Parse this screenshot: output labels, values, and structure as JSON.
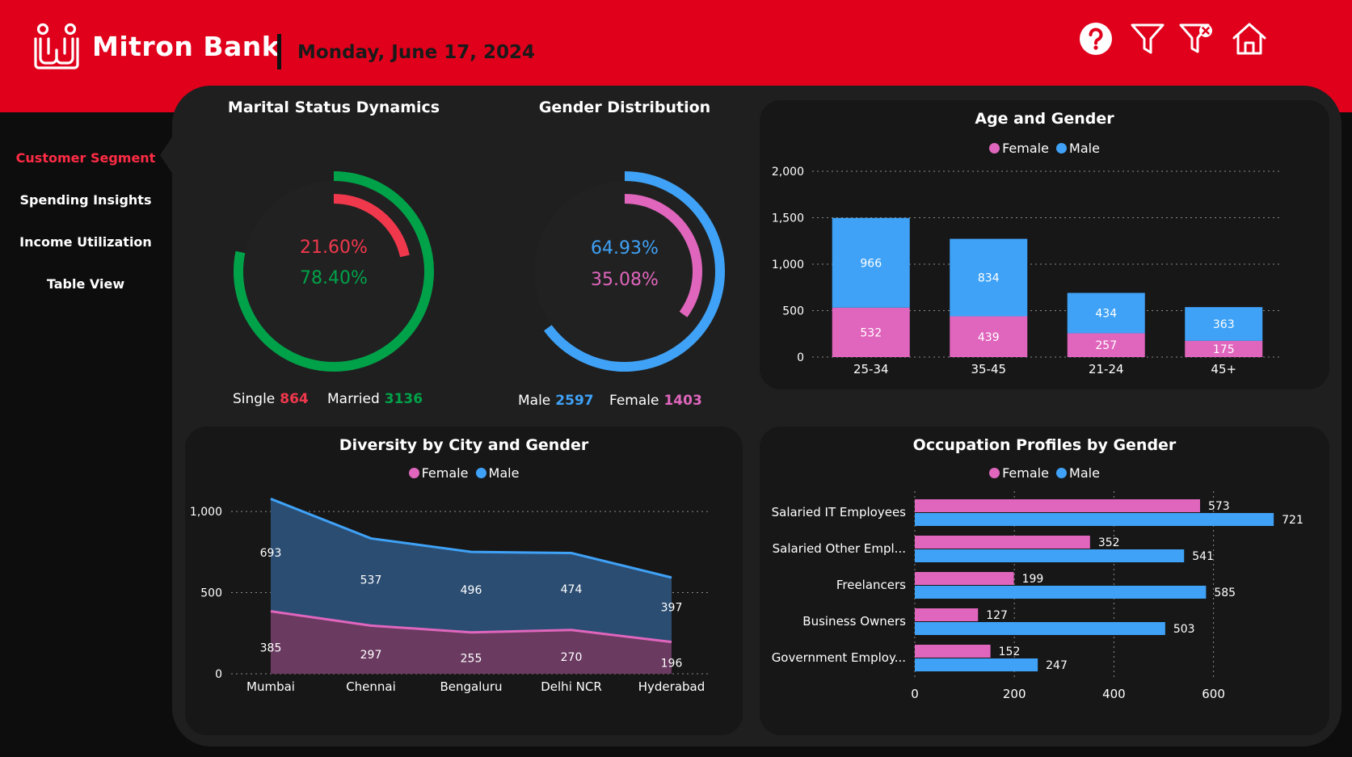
{
  "app": {
    "brand": "Mitron Bank",
    "date": "Monday, June 17, 2024"
  },
  "toolbar": {
    "icons": [
      "help-icon",
      "filter-icon",
      "clear-filter-icon",
      "home-icon"
    ]
  },
  "nav": {
    "items": [
      {
        "label": "Customer Segment",
        "active": true
      },
      {
        "label": "Spending Insights",
        "active": false
      },
      {
        "label": "Income Utilization",
        "active": false
      },
      {
        "label": "Table View",
        "active": false
      }
    ]
  },
  "marital": {
    "title": "Marital Status Dynamics",
    "single_pct": "21.60%",
    "married_pct": "78.40%",
    "single_label": "Single",
    "single_value": "864",
    "married_label": "Married",
    "married_value": "3136",
    "colors": {
      "single": "#f0384d",
      "married": "#00a249"
    }
  },
  "gender": {
    "title": "Gender Distribution",
    "male_pct": "64.93%",
    "female_pct": "35.08%",
    "male_label": "Male",
    "male_value": "2597",
    "female_label": "Female",
    "female_value": "1403",
    "colors": {
      "male": "#3fa2f7",
      "female": "#e066bd"
    }
  },
  "legend": {
    "female": "Female",
    "male": "Male"
  },
  "chart_data": [
    {
      "id": "age",
      "type": "bar",
      "stacked": true,
      "title": "Age and Gender",
      "categories": [
        "25-34",
        "35-45",
        "21-24",
        "45+"
      ],
      "series": [
        {
          "name": "Female",
          "values": [
            532,
            439,
            257,
            175
          ],
          "color": "#e066bd"
        },
        {
          "name": "Male",
          "values": [
            966,
            834,
            434,
            363
          ],
          "color": "#3fa2f7"
        }
      ],
      "ylim": [
        0,
        2000
      ],
      "yticks": [
        "0",
        "500",
        "1,000",
        "1,500",
        "2,000"
      ],
      "grid": true,
      "legend_position": "top"
    },
    {
      "id": "city",
      "type": "area",
      "title": "Diversity by City and Gender",
      "categories": [
        "Mumbai",
        "Chennai",
        "Bengaluru",
        "Delhi NCR",
        "Hyderabad"
      ],
      "series": [
        {
          "name": "Female",
          "values": [
            385,
            297,
            255,
            270,
            196
          ],
          "color": "#e066bd"
        },
        {
          "name": "Male",
          "values": [
            693,
            537,
            496,
            474,
            397
          ],
          "color": "#3fa2f7"
        }
      ],
      "ylim": [
        0,
        1100
      ],
      "yticks": [
        "0",
        "500",
        "1,000"
      ],
      "grid": true,
      "legend_position": "top"
    },
    {
      "id": "occupation",
      "type": "bar",
      "orientation": "horizontal",
      "title": "Occupation Profiles by Gender",
      "categories": [
        "Salaried IT Employees",
        "Salaried Other Empl...",
        "Freelancers",
        "Business Owners",
        "Government Employ..."
      ],
      "series": [
        {
          "name": "Female",
          "values": [
            573,
            352,
            199,
            127,
            152
          ],
          "color": "#e066bd"
        },
        {
          "name": "Male",
          "values": [
            721,
            541,
            585,
            503,
            247
          ],
          "color": "#3fa2f7"
        }
      ],
      "xlim": [
        0,
        800
      ],
      "xticks": [
        "0",
        "200",
        "400",
        "600"
      ],
      "grid": true,
      "legend_position": "top"
    }
  ]
}
